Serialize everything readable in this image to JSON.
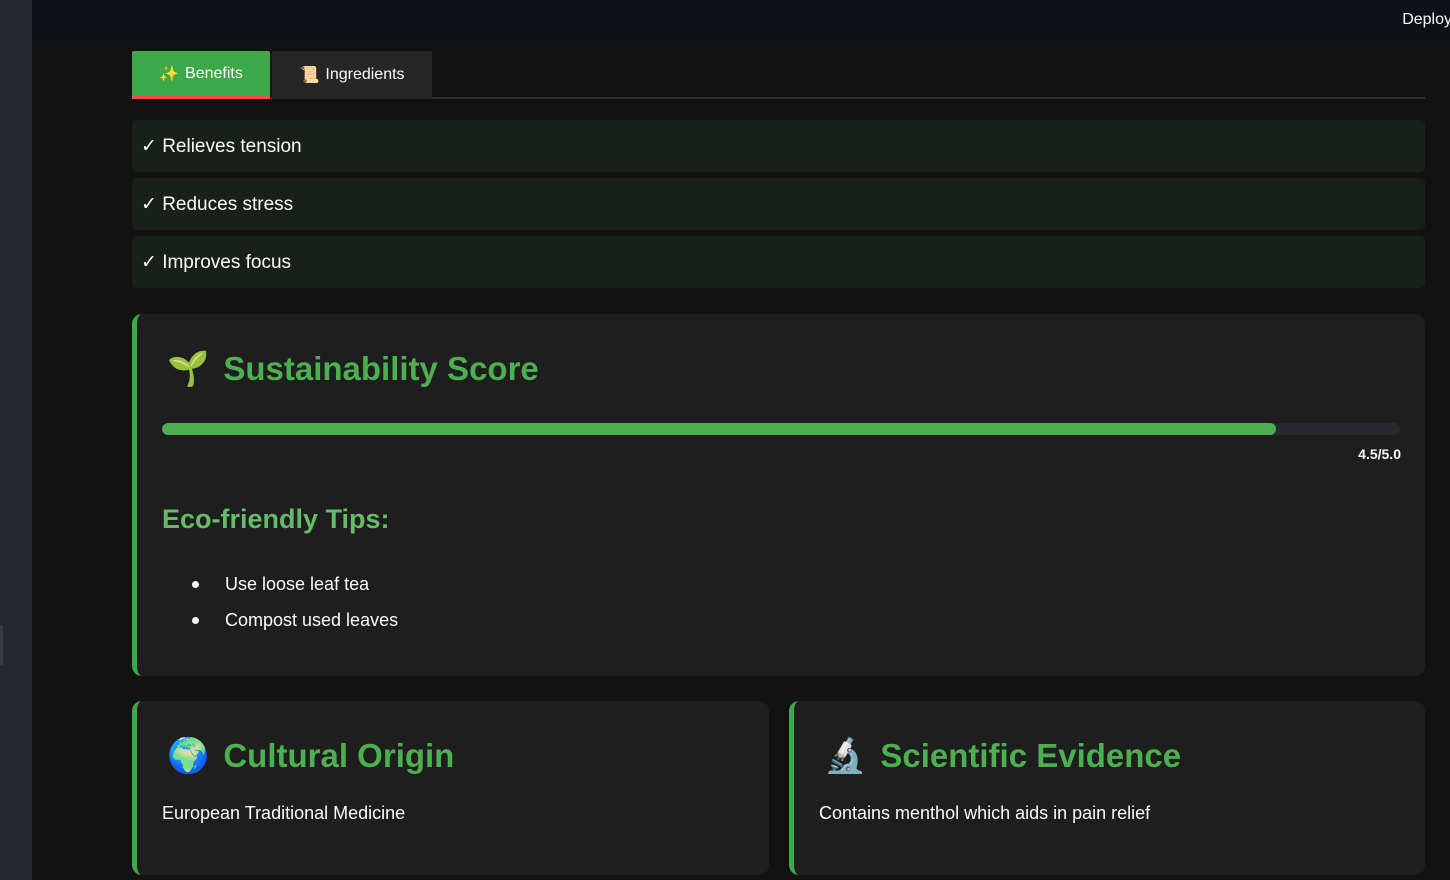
{
  "topbar": {
    "deploy_label": "Deploy"
  },
  "tabs": [
    {
      "icon": "✨",
      "icon_name": "sparkles-icon",
      "label": "Benefits",
      "active": true
    },
    {
      "icon": "📜",
      "icon_name": "scroll-icon",
      "label": "Ingredients",
      "active": false
    }
  ],
  "benefits": [
    "✓ Relieves tension",
    "✓ Reduces stress",
    "✓ Improves focus"
  ],
  "sustainability": {
    "icon": "🌱",
    "icon_name": "seedling-icon",
    "title": "Sustainability Score",
    "score": 4.5,
    "max": 5.0,
    "score_label": "4.5/5.0",
    "tips_title": "Eco-friendly Tips:",
    "tips": [
      "Use loose leaf tea",
      "Compost used leaves"
    ]
  },
  "cultural_origin": {
    "icon": "🌍",
    "icon_name": "globe-icon",
    "title": "Cultural Origin",
    "text": "European Traditional Medicine"
  },
  "scientific_evidence": {
    "icon": "🔬",
    "icon_name": "microscope-icon",
    "title": "Scientific Evidence",
    "text": "Contains menthol which aids in pain relief"
  },
  "colors": {
    "accent_green": "#4caf50",
    "tab_active_bg": "#3da84a",
    "tab_active_underline": "#ff4b4b",
    "card_bg": "#1e1e1e",
    "benefit_bg": "#192019"
  }
}
